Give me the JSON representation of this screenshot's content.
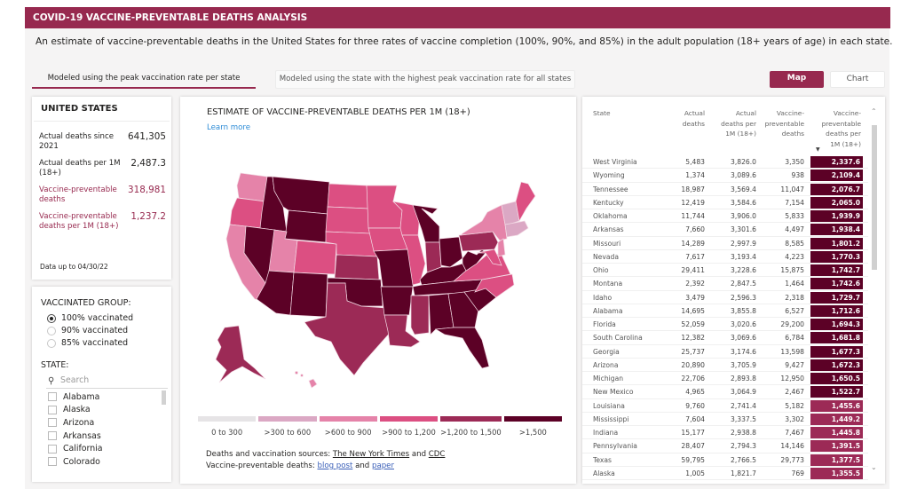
{
  "header": {
    "title": "COVID-19 VACCINE-PREVENTABLE DEATHS ANALYSIS",
    "subtitle": "An estimate of vaccine-preventable deaths in the United States for three rates of vaccine completion (100%, 90%, and 85%) in the adult population (18+ years of age) in each state."
  },
  "tabs": [
    {
      "label": "Modeled using the peak vaccination rate per state",
      "active": true
    },
    {
      "label": "Modeled using the state with the highest peak vaccination rate for all states",
      "active": false
    }
  ],
  "view_buttons": {
    "map": "Map",
    "chart": "Chart",
    "active": "map"
  },
  "us_summary": {
    "title": "UNITED STATES",
    "kpis": [
      {
        "label": "Actual deaths since 2021",
        "value": "641,305"
      },
      {
        "label": "Actual deaths per 1M (18+)",
        "value": "2,487.3"
      },
      {
        "label": "Vaccine-preventable deaths",
        "value": "318,981"
      },
      {
        "label": "Vaccine-preventable deaths per 1M (18+)",
        "value": "1,237.2"
      }
    ],
    "data_up_to": "Data up to 04/30/22"
  },
  "filters": {
    "vaccinated_group_title": "VACCINATED GROUP:",
    "vaccinated_options": [
      {
        "label": "100% vaccinated",
        "selected": true
      },
      {
        "label": "90% vaccinated",
        "selected": false
      },
      {
        "label": "85% vaccinated",
        "selected": false
      }
    ],
    "state_title": "STATE:",
    "search_placeholder": "Search",
    "search_icon": "search-icon",
    "states": [
      "Alabama",
      "Alaska",
      "Arizona",
      "Arkansas",
      "California",
      "Colorado"
    ]
  },
  "map": {
    "title": "ESTIMATE OF VACCINE-PREVENTABLE DEATHS PER 1M (18+)",
    "learn_more": "Learn more",
    "legend": [
      {
        "label": "0 to 300",
        "color": "#e6e4e6"
      },
      {
        "label": ">300 to 600",
        "color": "#dba8c4"
      },
      {
        "label": ">600 to 900",
        "color": "#e583a9"
      },
      {
        "label": ">900 to 1,200",
        "color": "#dc4f82"
      },
      {
        "label": ">1,200 to 1,500",
        "color": "#9c2a56"
      },
      {
        "label": ">1,500",
        "color": "#5c0126"
      }
    ],
    "sources_line1_prefix": "Deaths and vaccination sources: ",
    "sources_nyt": "The New York Times",
    "sources_and": " and ",
    "sources_cdc": "CDC",
    "sources_line2_prefix": "Vaccine-preventable deaths: ",
    "sources_blog": "blog post",
    "sources_paper": "paper"
  },
  "table": {
    "columns": [
      "State",
      "Actual deaths",
      "Actual deaths per 1M (18+)",
      "Vaccine-preventable deaths",
      "Vaccine-preventable deaths per 1M (18+)"
    ],
    "column_lines": [
      [
        "State"
      ],
      [
        "Actual",
        "deaths"
      ],
      [
        "Actual",
        "deaths per",
        "1M (18+)"
      ],
      [
        "Vaccine-",
        "preventable",
        "deaths"
      ],
      [
        "Vaccine-",
        "preventable",
        "deaths per",
        "1M (18+)"
      ]
    ],
    "sort_column": "Vaccine-preventable deaths per 1M (18+)",
    "sort_direction": "descending",
    "rows": [
      [
        "West Virginia",
        "5,483",
        "3,826.0",
        "3,350",
        "2,337.6"
      ],
      [
        "Wyoming",
        "1,374",
        "3,089.6",
        "938",
        "2,109.4"
      ],
      [
        "Tennessee",
        "18,987",
        "3,569.4",
        "11,047",
        "2,076.7"
      ],
      [
        "Kentucky",
        "12,419",
        "3,584.6",
        "7,154",
        "2,065.0"
      ],
      [
        "Oklahoma",
        "11,744",
        "3,906.0",
        "5,833",
        "1,939.9"
      ],
      [
        "Arkansas",
        "7,660",
        "3,301.6",
        "4,497",
        "1,938.4"
      ],
      [
        "Missouri",
        "14,289",
        "2,997.9",
        "8,585",
        "1,801.2"
      ],
      [
        "Nevada",
        "7,617",
        "3,193.4",
        "4,223",
        "1,770.3"
      ],
      [
        "Ohio",
        "29,411",
        "3,228.6",
        "15,875",
        "1,742.7"
      ],
      [
        "Montana",
        "2,392",
        "2,847.5",
        "1,464",
        "1,742.6"
      ],
      [
        "Idaho",
        "3,479",
        "2,596.3",
        "2,318",
        "1,729.7"
      ],
      [
        "Alabama",
        "14,695",
        "3,855.8",
        "6,527",
        "1,712.6"
      ],
      [
        "Florida",
        "52,059",
        "3,020.6",
        "29,200",
        "1,694.3"
      ],
      [
        "South Carolina",
        "12,382",
        "3,069.6",
        "6,784",
        "1,681.8"
      ],
      [
        "Georgia",
        "25,737",
        "3,174.6",
        "13,598",
        "1,677.3"
      ],
      [
        "Arizona",
        "20,890",
        "3,705.9",
        "9,427",
        "1,672.3"
      ],
      [
        "Michigan",
        "22,706",
        "2,893.8",
        "12,950",
        "1,650.5"
      ],
      [
        "New Mexico",
        "4,965",
        "3,064.9",
        "2,467",
        "1,522.7"
      ],
      [
        "Louisiana",
        "9,760",
        "2,741.4",
        "5,182",
        "1,455.6"
      ],
      [
        "Mississippi",
        "7,604",
        "3,337.5",
        "3,302",
        "1,449.2"
      ],
      [
        "Indiana",
        "15,177",
        "2,938.8",
        "7,467",
        "1,445.8"
      ],
      [
        "Pennsylvania",
        "28,407",
        "2,794.3",
        "14,146",
        "1,391.5"
      ],
      [
        "Texas",
        "59,795",
        "2,766.5",
        "29,773",
        "1,377.5"
      ],
      [
        "Alaska",
        "1,005",
        "1,821.7",
        "769",
        "1,355.5"
      ]
    ]
  }
}
